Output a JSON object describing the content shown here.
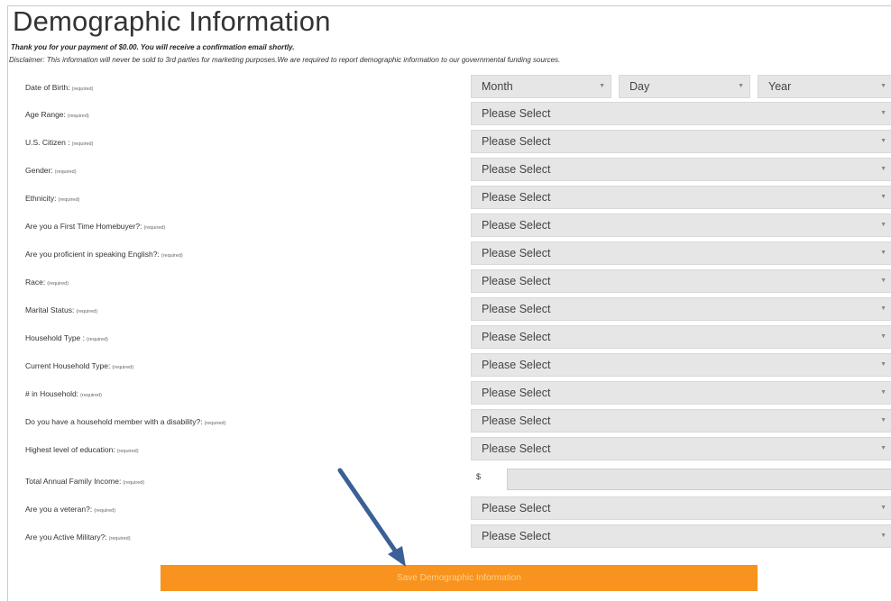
{
  "page": {
    "title": "Demographic Information",
    "thanks": "Thank you for your payment of $0.00. You will receive a confirmation email shortly.",
    "disclaimer": "Disclaimer: This information will never be sold to 3rd parties for marketing purposes.We are required to report demographic information to our governmental funding sources.",
    "required_tag": "(required)"
  },
  "dob": {
    "label": "Date of Birth:",
    "month": "Month",
    "day": "Day",
    "year": "Year"
  },
  "fields": [
    {
      "label": "Age Range:",
      "value": "Please Select"
    },
    {
      "label": "U.S. Citizen :",
      "value": "Please Select"
    },
    {
      "label": "Gender:",
      "value": "Please Select"
    },
    {
      "label": "Ethnicity:",
      "value": "Please Select"
    },
    {
      "label": "Are you a First Time Homebuyer?:",
      "value": "Please Select"
    },
    {
      "label": "Are you proficient in speaking English?:",
      "value": "Please Select"
    },
    {
      "label": "Race:",
      "value": "Please Select"
    },
    {
      "label": "Marital Status:",
      "value": "Please Select"
    },
    {
      "label": "Household Type :",
      "value": "Please Select"
    },
    {
      "label": "Current Household Type:",
      "value": "Please Select"
    },
    {
      "label": "# in Household:",
      "value": "Please Select"
    },
    {
      "label": "Do you have a household member with a disability?:",
      "value": "Please Select"
    },
    {
      "label": "Highest level of education:",
      "value": "Please Select"
    }
  ],
  "income": {
    "label": "Total Annual Family Income:",
    "currency": "$",
    "value": ""
  },
  "fields_after": [
    {
      "label": "Are you a veteran?:",
      "value": "Please Select"
    },
    {
      "label": "Are you Active Military?:",
      "value": "Please Select"
    }
  ],
  "save_label": "Save Demographic Information",
  "icons": {
    "caret": "caret-down-icon",
    "annotation": "arrow-annotation-icon"
  },
  "colors": {
    "button": "#f7931e",
    "arrow": "#3b5f96"
  }
}
